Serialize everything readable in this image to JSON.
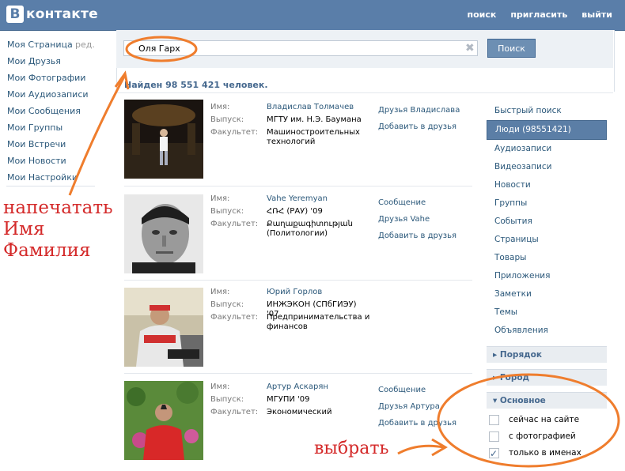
{
  "header": {
    "logo_letter": "В",
    "logo_text": "контакте",
    "nav": [
      "поиск",
      "пригласить",
      "выйти"
    ]
  },
  "left_menu": {
    "items": [
      "Моя Страница",
      "Мои Друзья",
      "Мои Фотографии",
      "Мои Аудиозаписи",
      "Мои Сообщения",
      "Мои Группы",
      "Мои Встречи",
      "Мои Новости",
      "Мои Настройки"
    ],
    "edit": "ред."
  },
  "search": {
    "value": "Оля Гарх",
    "clear_icon": "✖",
    "button": "Поиск",
    "found": "Найден 98 551 421 человек."
  },
  "results": [
    {
      "labels": [
        "Имя:",
        "Выпуск:",
        "Факультет:"
      ],
      "name": "Владислав Толмачев",
      "grad": "МГТУ им. Н.Э. Баумана",
      "faculty": "Машиностроительных технологий",
      "actions": [
        "Друзья Владислава",
        "Добавить в друзья"
      ]
    },
    {
      "labels": [
        "Имя:",
        "Выпуск:",
        "Факультет:"
      ],
      "name": "Vahe Yeremyan",
      "grad": "ՀՌՀ (РАУ) '09",
      "faculty": "Քաղաքագիտության (Политологии)",
      "actions": [
        "Сообщение",
        "Друзья Vahe",
        "Добавить в друзья"
      ]
    },
    {
      "labels": [
        "Имя:",
        "Выпуск:",
        "Факультет:"
      ],
      "name": "Юрий Горлов",
      "grad": "ИНЖЭКОН (СПбГИЭУ) '07",
      "faculty": "Предпринимательства и финансов",
      "actions": [
        "Друзья Юрия",
        "Добавить в друзья"
      ]
    },
    {
      "labels": [
        "Имя:",
        "Выпуск:",
        "Факультет:"
      ],
      "name": "Артур Аскарян",
      "grad": "МГУПИ '09",
      "faculty": "Экономический",
      "actions": [
        "Сообщение",
        "Друзья Артура",
        "Добавить в друзья"
      ]
    }
  ],
  "right_menu": {
    "items": [
      "Быстрый поиск",
      "Люди (98551421)",
      "Аудиозаписи",
      "Видеозаписи",
      "Новости",
      "Группы",
      "События",
      "Страницы",
      "Товары",
      "Приложения",
      "Заметки",
      "Темы",
      "Объявления"
    ],
    "sections": [
      "▸ Порядок",
      "▸ Город",
      "▾ Основное"
    ],
    "checks": [
      {
        "label": "сейчас на сайте",
        "checked": false
      },
      {
        "label": "с фотографией",
        "checked": false
      },
      {
        "label": "только в именах",
        "checked": true
      }
    ]
  },
  "annotations": {
    "left": [
      "напечатать",
      "Имя",
      "Фамилия"
    ],
    "bottom": "выбрать",
    "color": "#ef7d2d"
  }
}
